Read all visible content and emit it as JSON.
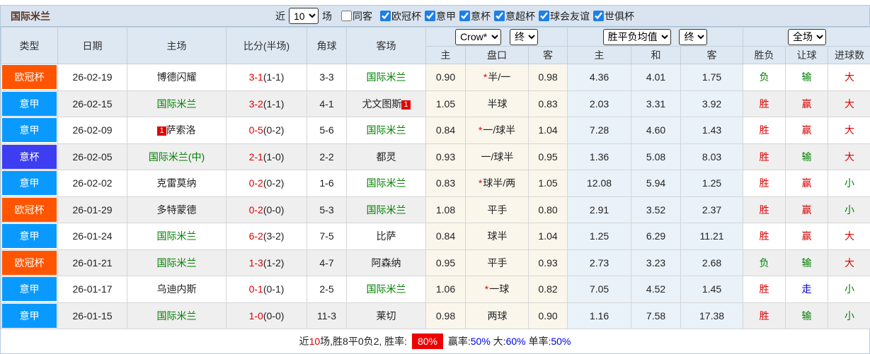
{
  "palette": {
    "toolbar_bg": "#d9e4f0",
    "header_bg": "#dde8f2",
    "stripe_bg": "#efefef",
    "crow_col_bg": "#fbf6eb",
    "avg_col_bg": "#e9f2f9",
    "league_ucl": "#ff5500",
    "league_seriea": "#0a9aff",
    "league_cup": "#3d3df2",
    "win_red": "#dd0000",
    "lose_green": "#008000",
    "draw_blue": "#0000cc",
    "checkbox_blue": "#1d7fe8"
  },
  "toolbar": {
    "title": "国际米兰",
    "recent_label": "近",
    "recent_count": "10",
    "games_label": "场",
    "same_venue": {
      "label": "同客",
      "checked": false
    },
    "league_filters": [
      {
        "label": "欧冠杯",
        "checked": true
      },
      {
        "label": "意甲",
        "checked": true
      },
      {
        "label": "意杯",
        "checked": true
      },
      {
        "label": "意超杯",
        "checked": true
      },
      {
        "label": "球会友谊",
        "checked": true
      },
      {
        "label": "世俱杯",
        "checked": true
      }
    ]
  },
  "table": {
    "columns": [
      "类型",
      "日期",
      "主场",
      "比分(半场)",
      "角球",
      "客场"
    ],
    "dropdowns": {
      "company": "Crow*",
      "stage1": "终",
      "avg": "胜平负均值",
      "stage2": "终",
      "scope": "全场"
    },
    "sub_columns": [
      "主",
      "盘口",
      "客",
      "主",
      "和",
      "客",
      "胜负",
      "让球",
      "进球数"
    ],
    "rows": [
      {
        "league": "欧冠杯",
        "league_cls": "badge-ucl",
        "date": "26-02-19",
        "home": "博德闪耀",
        "home_cls": "",
        "home_pre": "",
        "home_post": "",
        "score": "3-1",
        "half": "(1-1)",
        "corner": "3-3",
        "away": "国际米兰",
        "away_cls": "t-green",
        "away_pre": "",
        "away_post": "",
        "h_odds": "0.90",
        "star": "*",
        "handicap": "半/一",
        "a_odds": "0.98",
        "avg_h": "4.36",
        "avg_d": "4.01",
        "avg_a": "1.75",
        "result": "负",
        "result_cls": "t-green",
        "hresult": "输",
        "hresult_cls": "t-green",
        "goals": "大",
        "goals_cls": "t-red"
      },
      {
        "league": "意甲",
        "league_cls": "badge-seriea",
        "date": "26-02-15",
        "home": "国际米兰",
        "home_cls": "t-green",
        "home_pre": "",
        "home_post": "",
        "score": "3-2",
        "half": "(1-1)",
        "corner": "4-1",
        "away": "尤文图斯",
        "away_cls": "",
        "away_pre": "",
        "away_post": "1",
        "h_odds": "1.05",
        "star": "",
        "handicap": "半球",
        "a_odds": "0.83",
        "avg_h": "2.03",
        "avg_d": "3.31",
        "avg_a": "3.92",
        "result": "胜",
        "result_cls": "t-red",
        "hresult": "赢",
        "hresult_cls": "t-red",
        "goals": "大",
        "goals_cls": "t-red"
      },
      {
        "league": "意甲",
        "league_cls": "badge-seriea",
        "date": "26-02-09",
        "home": "萨索洛",
        "home_cls": "",
        "home_pre": "1",
        "home_post": "",
        "score": "0-5",
        "half": "(0-2)",
        "corner": "5-6",
        "away": "国际米兰",
        "away_cls": "t-green",
        "away_pre": "",
        "away_post": "",
        "h_odds": "0.84",
        "star": "*",
        "handicap": "一/球半",
        "a_odds": "1.04",
        "avg_h": "7.28",
        "avg_d": "4.60",
        "avg_a": "1.43",
        "result": "胜",
        "result_cls": "t-red",
        "hresult": "赢",
        "hresult_cls": "t-red",
        "goals": "大",
        "goals_cls": "t-red"
      },
      {
        "league": "意杯",
        "league_cls": "badge-cup",
        "date": "26-02-05",
        "home": "国际米兰(中)",
        "home_cls": "t-green",
        "home_pre": "",
        "home_post": "",
        "score": "2-1",
        "half": "(1-0)",
        "corner": "2-2",
        "away": "都灵",
        "away_cls": "",
        "away_pre": "",
        "away_post": "",
        "h_odds": "0.93",
        "star": "",
        "handicap": "一/球半",
        "a_odds": "0.95",
        "avg_h": "1.36",
        "avg_d": "5.08",
        "avg_a": "8.03",
        "result": "胜",
        "result_cls": "t-red",
        "hresult": "输",
        "hresult_cls": "t-green",
        "goals": "大",
        "goals_cls": "t-red"
      },
      {
        "league": "意甲",
        "league_cls": "badge-seriea",
        "date": "26-02-02",
        "home": "克雷莫纳",
        "home_cls": "",
        "home_pre": "",
        "home_post": "",
        "score": "0-2",
        "half": "(0-2)",
        "corner": "1-6",
        "away": "国际米兰",
        "away_cls": "t-green",
        "away_pre": "",
        "away_post": "",
        "h_odds": "0.83",
        "star": "*",
        "handicap": "球半/两",
        "a_odds": "1.05",
        "avg_h": "12.08",
        "avg_d": "5.94",
        "avg_a": "1.25",
        "result": "胜",
        "result_cls": "t-red",
        "hresult": "赢",
        "hresult_cls": "t-red",
        "goals": "小",
        "goals_cls": "t-green"
      },
      {
        "league": "欧冠杯",
        "league_cls": "badge-ucl",
        "date": "26-01-29",
        "home": "多特蒙德",
        "home_cls": "",
        "home_pre": "",
        "home_post": "",
        "score": "0-2",
        "half": "(0-0)",
        "corner": "5-3",
        "away": "国际米兰",
        "away_cls": "t-green",
        "away_pre": "",
        "away_post": "",
        "h_odds": "1.08",
        "star": "",
        "handicap": "平手",
        "a_odds": "0.80",
        "avg_h": "2.91",
        "avg_d": "3.52",
        "avg_a": "2.37",
        "result": "胜",
        "result_cls": "t-red",
        "hresult": "赢",
        "hresult_cls": "t-red",
        "goals": "小",
        "goals_cls": "t-green"
      },
      {
        "league": "意甲",
        "league_cls": "badge-seriea",
        "date": "26-01-24",
        "home": "国际米兰",
        "home_cls": "t-green",
        "home_pre": "",
        "home_post": "",
        "score": "6-2",
        "half": "(3-2)",
        "corner": "7-5",
        "away": "比萨",
        "away_cls": "",
        "away_pre": "",
        "away_post": "",
        "h_odds": "0.84",
        "star": "",
        "handicap": "球半",
        "a_odds": "1.04",
        "avg_h": "1.25",
        "avg_d": "6.29",
        "avg_a": "11.21",
        "result": "胜",
        "result_cls": "t-red",
        "hresult": "赢",
        "hresult_cls": "t-red",
        "goals": "大",
        "goals_cls": "t-red"
      },
      {
        "league": "欧冠杯",
        "league_cls": "badge-ucl",
        "date": "26-01-21",
        "home": "国际米兰",
        "home_cls": "t-green",
        "home_pre": "",
        "home_post": "",
        "score": "1-3",
        "half": "(1-2)",
        "corner": "4-7",
        "away": "阿森纳",
        "away_cls": "",
        "away_pre": "",
        "away_post": "",
        "h_odds": "0.95",
        "star": "",
        "handicap": "平手",
        "a_odds": "0.93",
        "avg_h": "2.73",
        "avg_d": "3.23",
        "avg_a": "2.68",
        "result": "负",
        "result_cls": "t-green",
        "hresult": "输",
        "hresult_cls": "t-green",
        "goals": "大",
        "goals_cls": "t-red"
      },
      {
        "league": "意甲",
        "league_cls": "badge-seriea",
        "date": "26-01-17",
        "home": "乌迪内斯",
        "home_cls": "",
        "home_pre": "",
        "home_post": "",
        "score": "0-1",
        "half": "(0-1)",
        "corner": "2-5",
        "away": "国际米兰",
        "away_cls": "t-green",
        "away_pre": "",
        "away_post": "",
        "h_odds": "1.06",
        "star": "*",
        "handicap": "一球",
        "a_odds": "0.82",
        "avg_h": "7.05",
        "avg_d": "4.52",
        "avg_a": "1.45",
        "result": "胜",
        "result_cls": "t-red",
        "hresult": "走",
        "hresult_cls": "t-blue",
        "goals": "小",
        "goals_cls": "t-green"
      },
      {
        "league": "意甲",
        "league_cls": "badge-seriea",
        "date": "26-01-15",
        "home": "国际米兰",
        "home_cls": "t-green",
        "home_pre": "",
        "home_post": "",
        "score": "1-0",
        "half": "(0-0)",
        "corner": "11-3",
        "away": "莱切",
        "away_cls": "",
        "away_pre": "",
        "away_post": "",
        "h_odds": "0.98",
        "star": "",
        "handicap": "两球",
        "a_odds": "0.90",
        "avg_h": "1.16",
        "avg_d": "7.58",
        "avg_a": "17.38",
        "result": "胜",
        "result_cls": "t-red",
        "hresult": "输",
        "hresult_cls": "t-green",
        "goals": "小",
        "goals_cls": "t-green"
      }
    ]
  },
  "footer": {
    "segments": [
      {
        "text": "近",
        "cls": ""
      },
      {
        "text": "10",
        "cls": "t-red"
      },
      {
        "text": "场,胜8平0负2, 胜率: ",
        "cls": ""
      },
      {
        "text": "80%",
        "cls": "hl-red"
      },
      {
        "text": " 赢率:",
        "cls": ""
      },
      {
        "text": "50%",
        "cls": "t-blue2"
      },
      {
        "text": " 大:",
        "cls": ""
      },
      {
        "text": "60%",
        "cls": "t-blue2"
      },
      {
        "text": " 单率:",
        "cls": ""
      },
      {
        "text": "50%",
        "cls": "t-blue2"
      }
    ]
  }
}
